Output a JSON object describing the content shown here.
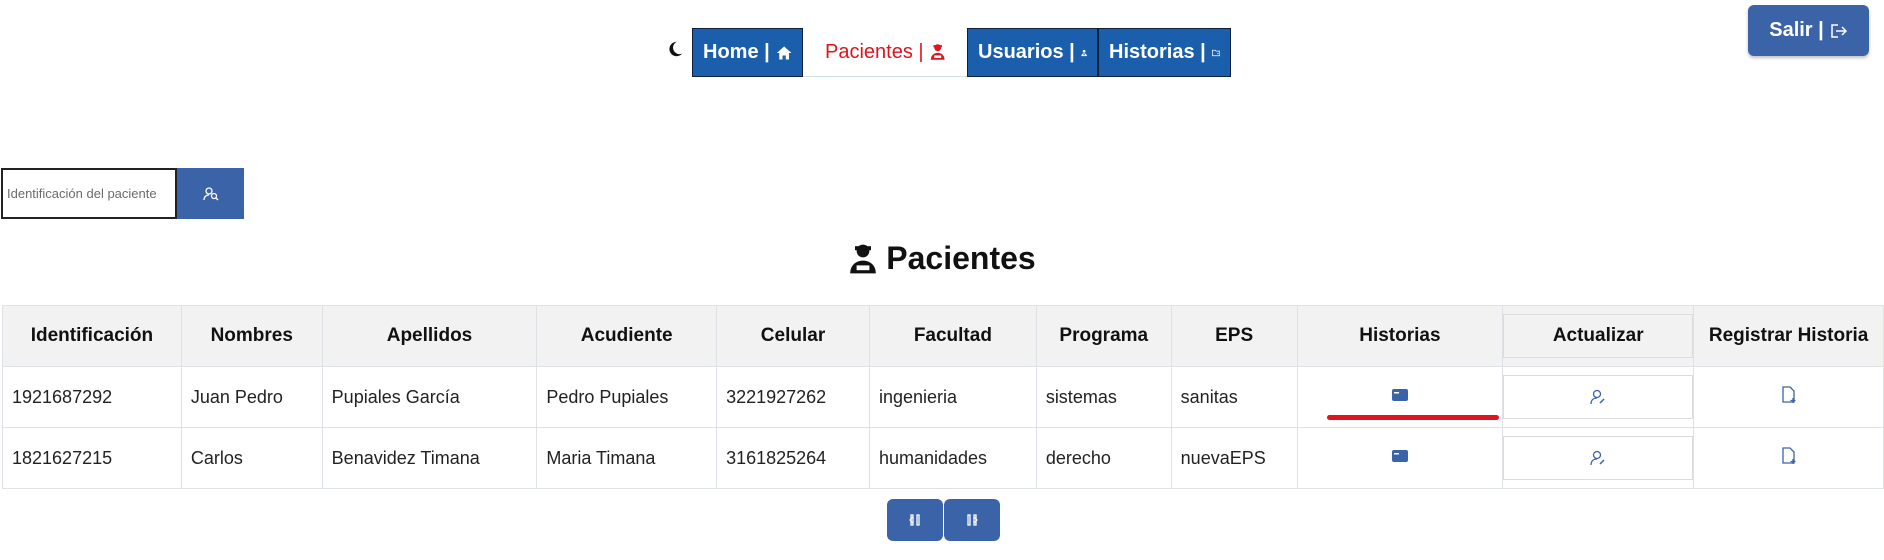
{
  "nav": {
    "theme_icon": "moon-icon",
    "items": [
      {
        "label": "Home |",
        "icon": "home-icon"
      },
      {
        "label": "Pacientes |",
        "icon": "patient-icon"
      },
      {
        "label": "Usuarios |",
        "icon": "doctor-icon"
      },
      {
        "label": "Historias |",
        "icon": "folder-icon"
      }
    ],
    "logout": {
      "label": "Salir |",
      "icon": "logout-icon"
    }
  },
  "search": {
    "placeholder": "Identificación del paciente",
    "button_icon": "search-user-icon"
  },
  "page": {
    "title": "Pacientes",
    "title_icon": "patient-icon"
  },
  "table": {
    "columns": [
      "Identificación",
      "Nombres",
      "Apellidos",
      "Acudiente",
      "Celular",
      "Facultad",
      "Programa",
      "EPS",
      "Historias",
      "Actualizar",
      "Registrar Historia"
    ],
    "rows": [
      {
        "id": "1921687292",
        "nombres": "Juan Pedro",
        "apellidos": "Pupiales García",
        "acudiente": "Pedro Pupiales",
        "celular": "3221927262",
        "facultad": "ingenieria",
        "programa": "sistemas",
        "eps": "sanitas"
      },
      {
        "id": "1821627215",
        "nombres": "Carlos",
        "apellidos": "Benavidez Timana",
        "acudiente": "Maria Timana",
        "celular": "3161825264",
        "facultad": "humanidades",
        "programa": "derecho",
        "eps": "nuevaEPS"
      }
    ],
    "row_icons": {
      "historias": "history-card-icon",
      "actualizar": "edit-user-icon",
      "registrar": "add-file-icon"
    }
  },
  "pager": {
    "prev_icon": "prev-page-icon",
    "next_icon": "next-page-icon"
  },
  "colors": {
    "primary": "#1b5eab",
    "button": "#3b63a8",
    "active": "#e0141e"
  }
}
